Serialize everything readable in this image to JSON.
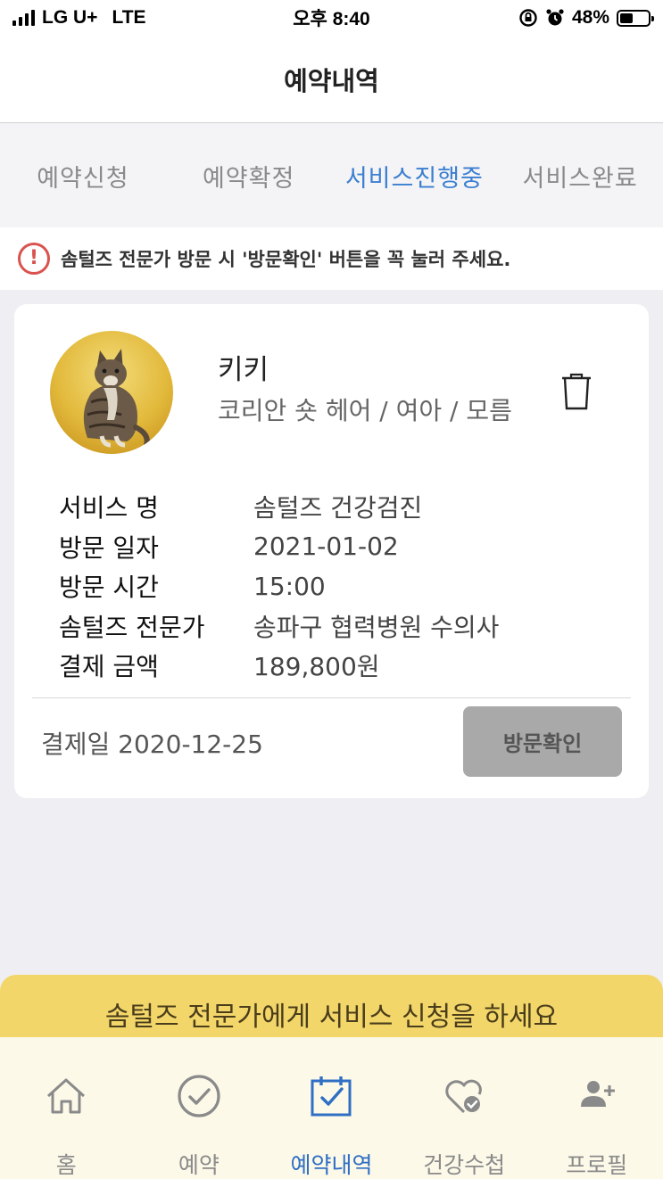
{
  "statusbar": {
    "carrier": "LG U+",
    "network": "LTE",
    "time": "오후 8:40",
    "battery": "48%",
    "battery_level": 0.48
  },
  "header": {
    "title": "예약내역"
  },
  "tabs": [
    {
      "label": "예약신청"
    },
    {
      "label": "예약확정"
    },
    {
      "label": "서비스진행중"
    },
    {
      "label": "서비스완료"
    }
  ],
  "notice": {
    "icon_glyph": "!",
    "text": "솜털즈 전문가 방문 시 '방문확인' 버튼을 꼭 눌러 주세요."
  },
  "reservation": {
    "pet_name": "키키",
    "pet_info": "코리안 숏 헤어 / 여아 / 모름",
    "details": [
      {
        "label": "서비스 명",
        "value": "솜털즈 건강검진"
      },
      {
        "label": "방문 일자",
        "value": "2021-01-02"
      },
      {
        "label": "방문 시간",
        "value": "15:00"
      },
      {
        "label": "솜털즈 전문가",
        "value": "송파구 협력병원 수의사"
      },
      {
        "label": "결제 금액",
        "value": "189,800원"
      }
    ],
    "pay_date": "결제일 2020-12-25",
    "confirm_label": "방문확인"
  },
  "promo": {
    "text": "솜털즈 전문가에게 서비스 신청을 하세요"
  },
  "tabbar": [
    {
      "label": "홈",
      "icon": "home-icon"
    },
    {
      "label": "예약",
      "icon": "check-circle-icon"
    },
    {
      "label": "예약내역",
      "icon": "calendar-check-icon"
    },
    {
      "label": "건강수첩",
      "icon": "heart-check-icon"
    },
    {
      "label": "프로필",
      "icon": "user-plus-icon"
    }
  ],
  "colors": {
    "accent": "#3b7fd1",
    "alert": "#d9534f",
    "promo": "#f3d66a",
    "button_disabled": "#a9a9a9"
  }
}
